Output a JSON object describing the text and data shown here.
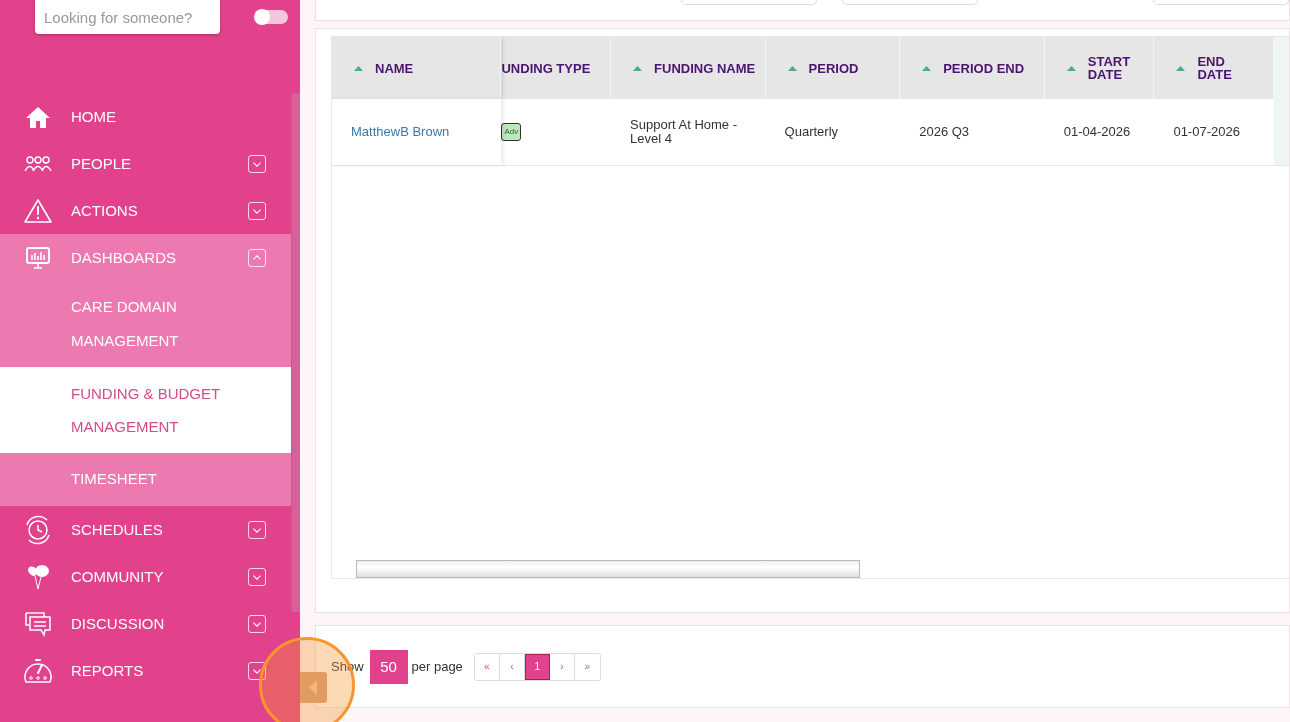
{
  "sidebar": {
    "search": {
      "placeholder": "Looking for someone?"
    },
    "toggle": {
      "on": false
    },
    "items": [
      {
        "label": "HOME",
        "expandable": false,
        "expanded": false
      },
      {
        "label": "PEOPLE",
        "expandable": true,
        "expanded": false
      },
      {
        "label": "ACTIONS",
        "expandable": true,
        "expanded": false
      },
      {
        "label": "DASHBOARDS",
        "expandable": true,
        "expanded": true,
        "children": [
          {
            "label": "CARE DOMAIN MANAGEMENT",
            "selected": false
          },
          {
            "label": "FUNDING & BUDGET MANAGEMENT",
            "selected": true
          },
          {
            "label": "TIMESHEET",
            "selected": false
          }
        ]
      },
      {
        "label": "SCHEDULES",
        "expandable": true,
        "expanded": false
      },
      {
        "label": "COMMUNITY",
        "expandable": true,
        "expanded": false
      },
      {
        "label": "DISCUSSION",
        "expandable": true,
        "expanded": false
      },
      {
        "label": "REPORTS",
        "expandable": true,
        "expanded": false
      }
    ]
  },
  "table": {
    "columns": [
      {
        "label": "NAME",
        "sort_arrow": true
      },
      {
        "label": "UNDING TYPE",
        "sort_arrow": false
      },
      {
        "label": "FUNDING NAME",
        "sort_arrow": true
      },
      {
        "label": "PERIOD",
        "sort_arrow": true
      },
      {
        "label": "PERIOD END",
        "sort_arrow": true
      },
      {
        "label": "START DATE",
        "sort_arrow": true
      },
      {
        "label": "END DATE",
        "sort_arrow": true
      }
    ],
    "rows": [
      {
        "name": "MatthewB Brown",
        "funding_type": "Adv",
        "funding_name": "Support At Home - Level 4",
        "period": "Quarterly",
        "period_end": "2026 Q3",
        "start_date": "01-04-2026",
        "end_date": "01-07-2026"
      }
    ]
  },
  "pagination": {
    "show_label": "Show",
    "per_page": "50",
    "per_page_label": "per page",
    "pages": [
      {
        "label": "«",
        "selected": false
      },
      {
        "label": "‹",
        "selected": false
      },
      {
        "label": "1",
        "selected": true
      },
      {
        "label": "›",
        "selected": false
      },
      {
        "label": "»",
        "selected": false
      }
    ]
  }
}
